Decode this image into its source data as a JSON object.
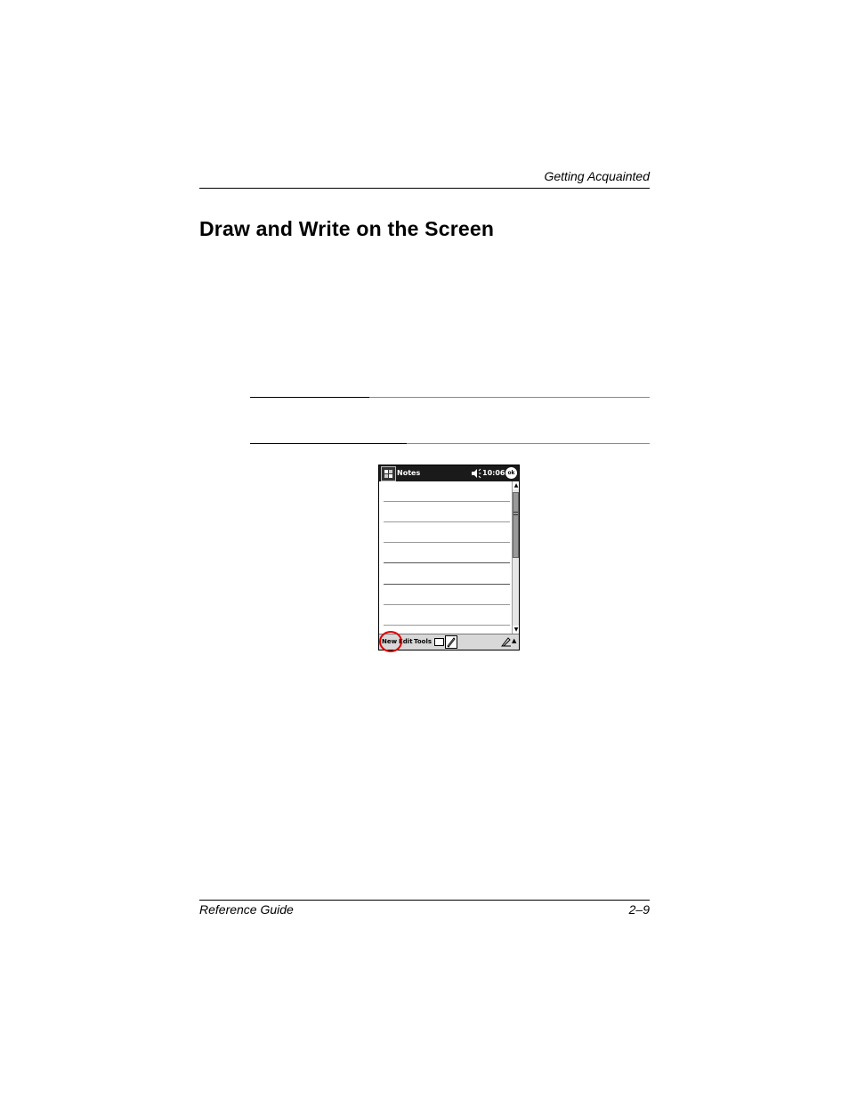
{
  "header": {
    "running_title": "Getting Acquainted"
  },
  "section": {
    "title": "Draw and Write on the Screen"
  },
  "device": {
    "app_title": "Notes",
    "clock": "10:06",
    "ok_label": "ok",
    "menu": {
      "new": "New",
      "edit": "Edit",
      "tools": "Tools"
    },
    "icons": [
      "start-flag-icon",
      "speaker-icon",
      "keyboard-icon",
      "pen-icon"
    ],
    "callout_color": "#e00000"
  },
  "footer": {
    "left": "Reference Guide",
    "right": "2–9"
  }
}
